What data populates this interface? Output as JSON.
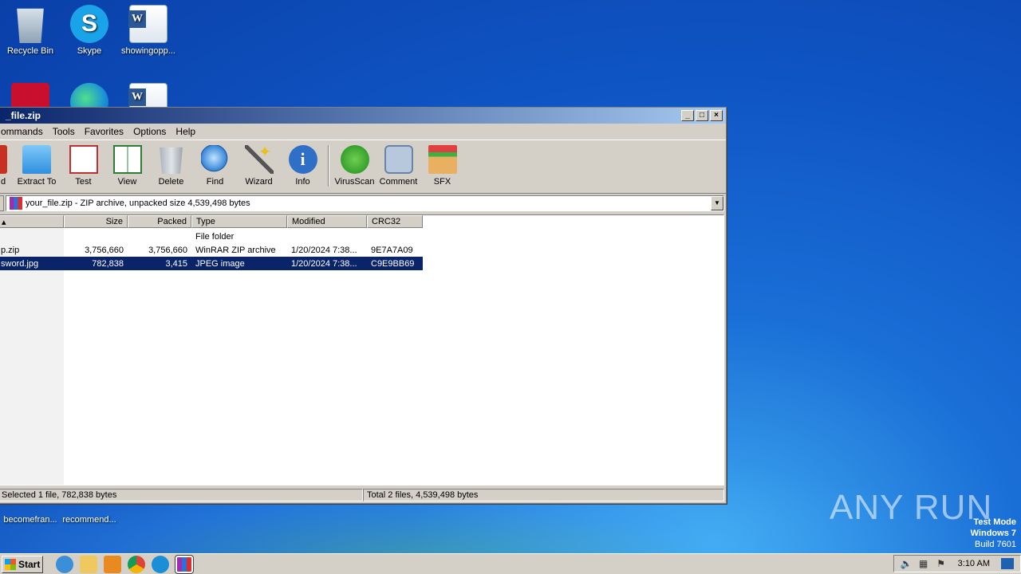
{
  "desktop": {
    "icons": [
      {
        "label": "Recycle Bin"
      },
      {
        "label": "Skype"
      },
      {
        "label": "showingopp..."
      },
      {
        "label": "becomefran..."
      },
      {
        "label": "recommend..."
      }
    ]
  },
  "window": {
    "title": "_file.zip",
    "buttons": {
      "minimize": "_",
      "maximize": "□",
      "close": "×"
    },
    "menu": [
      "ommands",
      "Tools",
      "Favorites",
      "Options",
      "Help"
    ],
    "toolbar": [
      "d",
      "Extract To",
      "Test",
      "View",
      "Delete",
      "Find",
      "Wizard",
      "Info",
      "VirusScan",
      "Comment",
      "SFX"
    ],
    "address": "your_file.zip - ZIP archive, unpacked size 4,539,498 bytes",
    "columns": [
      "",
      "Size",
      "Packed",
      "Type",
      "Modified",
      "CRC32"
    ],
    "rows": [
      {
        "name": "",
        "size": "",
        "packed": "",
        "type": "File folder",
        "modified": "",
        "crc": ""
      },
      {
        "name": "p.zip",
        "size": "3,756,660",
        "packed": "3,756,660",
        "type": "WinRAR ZIP archive",
        "modified": "1/20/2024 7:38...",
        "crc": "9E7A7A09"
      },
      {
        "name": "sword.jpg",
        "size": "782,838",
        "packed": "3,415",
        "type": "JPEG image",
        "modified": "1/20/2024 7:38...",
        "crc": "C9E9BB69"
      }
    ],
    "status_left": "Selected 1 file, 782,838 bytes",
    "status_right": "Total 2 files, 4,539,498 bytes"
  },
  "taskbar": {
    "start_label": "Start",
    "clock": "3:10 AM"
  },
  "watermark": {
    "line1": "Test Mode",
    "line2": "Windows 7",
    "line3": "Build 7601",
    "brand": "ANY RUN"
  }
}
